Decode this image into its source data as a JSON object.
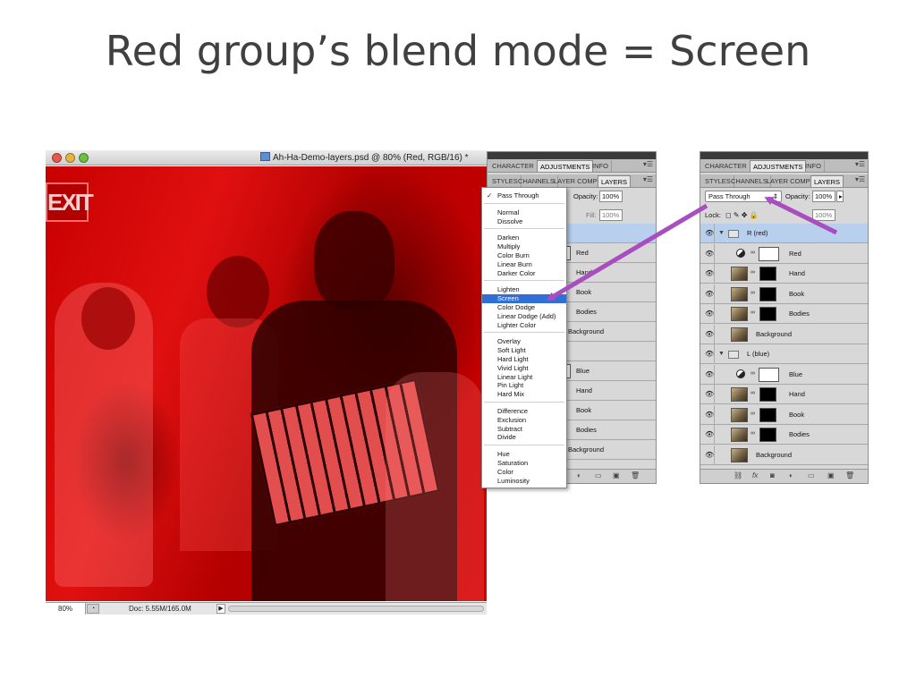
{
  "slide": {
    "title": "Red group’s blend mode = Screen"
  },
  "document": {
    "title": "Ah-Ha-Demo-layers.psd @ 80% (Red, RGB/16) *",
    "canvas_sign": "EXIT",
    "status": {
      "zoom": "80%",
      "doc_size": "Doc: 5.55M/165.0M",
      "arrow": "▶"
    }
  },
  "middle_panel": {
    "tabs_top": [
      "CHARACTER",
      "ADJUSTMENTS",
      "INFO"
    ],
    "tabs_second": [
      "STYLES",
      "CHANNELS",
      "LAYER COMP",
      "LAYERS"
    ],
    "menu": "▾☰",
    "opacity_label": "Opacity:",
    "opacity_value": "100%",
    "fill_label": "Fill:",
    "fill_value": "100%",
    "visible_layer_names": [
      "Red",
      "Hand",
      "Book",
      "Bodies",
      "Background",
      "Blue",
      "Hand",
      "Book",
      "Bodies",
      "Background"
    ]
  },
  "dropdown": {
    "selected": "Pass Through",
    "check": "✓",
    "groups": [
      [
        "Pass Through"
      ],
      [
        "Normal",
        "Dissolve"
      ],
      [
        "Darken",
        "Multiply",
        "Color Burn",
        "Linear Burn",
        "Darker Color"
      ],
      [
        "Lighten",
        "Screen",
        "Color Dodge",
        "Linear Dodge (Add)",
        "Lighter Color"
      ],
      [
        "Overlay",
        "Soft Light",
        "Hard Light",
        "Vivid Light",
        "Linear Light",
        "Pin Light",
        "Hard Mix"
      ],
      [
        "Difference",
        "Exclusion",
        "Subtract",
        "Divide"
      ],
      [
        "Hue",
        "Saturation",
        "Color",
        "Luminosity"
      ]
    ],
    "highlighted": "Screen"
  },
  "right_panel": {
    "tabs_top": [
      "CHARACTER",
      "ADJUSTMENTS",
      "INFO"
    ],
    "tabs_second": [
      "STYLES",
      "CHANNELS",
      "LAYER COMP",
      "LAYERS"
    ],
    "menu": "▾☰",
    "blend_mode": "Pass Through",
    "opacity_label": "Opacity:",
    "opacity_value": "100%",
    "lock_label": "Lock:",
    "fill_value": "100%",
    "groups": [
      {
        "name": "R (red)",
        "layers": [
          "Red",
          "Hand",
          "Book",
          "Bodies",
          "Background"
        ]
      },
      {
        "name": "L (blue)",
        "layers": [
          "Blue",
          "Hand",
          "Book",
          "Bodies",
          "Background"
        ]
      }
    ],
    "footer_icons": [
      "⛓",
      "fx",
      "◙",
      "◐",
      "▭",
      "▣",
      "🗑"
    ]
  },
  "icons": {
    "eye": "👁",
    "chain": "∞",
    "triangle": "▼",
    "spinner": "⇕"
  },
  "colors": {
    "arrow": "#a84ec0",
    "highlight": "#2f6fd6",
    "canvas_red": "#d10000"
  }
}
